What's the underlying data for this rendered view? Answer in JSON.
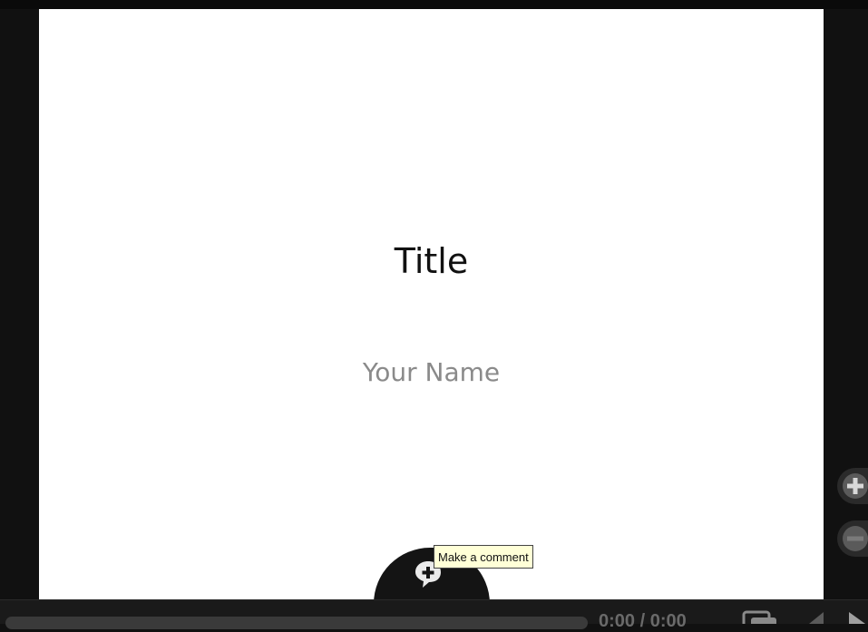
{
  "slide": {
    "title": "Title",
    "subtitle": "Your Name"
  },
  "comment": {
    "tooltip": "Make a comment"
  },
  "controls": {
    "time": "0:00 / 0:00",
    "zoom_in_icon": "plus-icon",
    "zoom_out_icon": "minus-icon",
    "slides_icon": "slides-icon",
    "prev_icon": "prev-icon",
    "next_icon": "next-icon"
  },
  "colors": {
    "background": "#111111",
    "slide": "#ffffff",
    "tooltip": "#ffffd7"
  }
}
